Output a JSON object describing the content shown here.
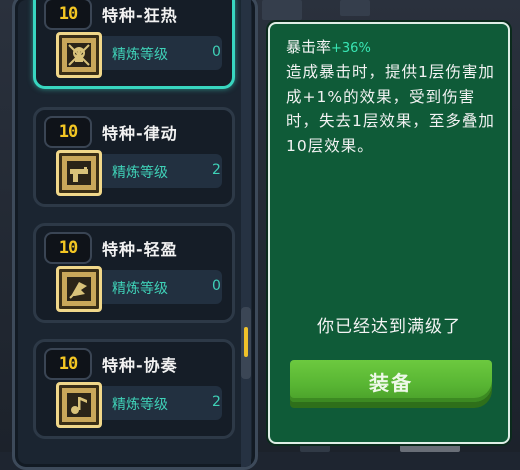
{
  "cards": [
    {
      "level": "10",
      "name": "特种-狂热",
      "refine_label": "精炼等级",
      "refine_value": "0",
      "selected": true,
      "chip_icon": "skull-chip-icon"
    },
    {
      "level": "10",
      "name": "特种-律动",
      "refine_label": "精炼等级",
      "refine_value": "2",
      "selected": false,
      "chip_icon": "gun-chip-icon"
    },
    {
      "level": "10",
      "name": "特种-轻盈",
      "refine_label": "精炼等级",
      "refine_value": "0",
      "selected": false,
      "chip_icon": "feather-chip-icon"
    },
    {
      "level": "10",
      "name": "特种-协奏",
      "refine_label": "精炼等级",
      "refine_value": "2",
      "selected": false,
      "chip_icon": "music-chip-icon"
    }
  ],
  "detail": {
    "attr_label": "暴击率",
    "attr_bonus": "+36%",
    "description": "造成暴击时，提供1层伤害加成+1%的效果，受到伤害时，失去1层效果，至多叠加10层效果。",
    "maxed_text": "你已经达到满级了",
    "equip_label": "装备"
  },
  "colors": {
    "accent": "#38d6c0",
    "level": "#f3c623",
    "refine": "#3fd1b7",
    "panel": "#0f5b38",
    "button": "#5cb934"
  }
}
